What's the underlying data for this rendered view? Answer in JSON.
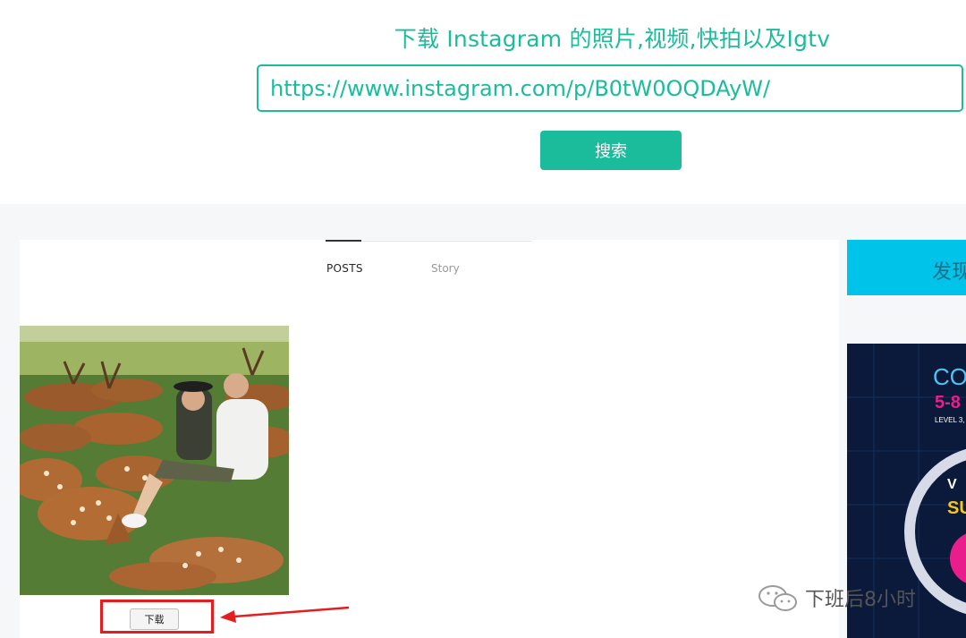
{
  "header": {
    "title": "下载 Instagram 的照片,视频,快拍以及Igtv",
    "url_value": "https://www.instagram.com/p/B0tW0OQDAyW/",
    "search_label": "搜索"
  },
  "tabs": [
    {
      "label": "POSTS",
      "active": true
    },
    {
      "label": "Story",
      "active": false
    }
  ],
  "post": {
    "download_label": "下载"
  },
  "ad": {
    "banner_text": "发现",
    "poster_lines": [
      "CO",
      "5-8",
      "LEVEL 3,",
      "V",
      "SU"
    ]
  },
  "watermark": {
    "text": "下班后8小时",
    "icon": "wechat-icon"
  },
  "colors": {
    "accent": "#1abc9c",
    "highlight": "#e41e1e",
    "ad_banner": "#00c3ea"
  }
}
